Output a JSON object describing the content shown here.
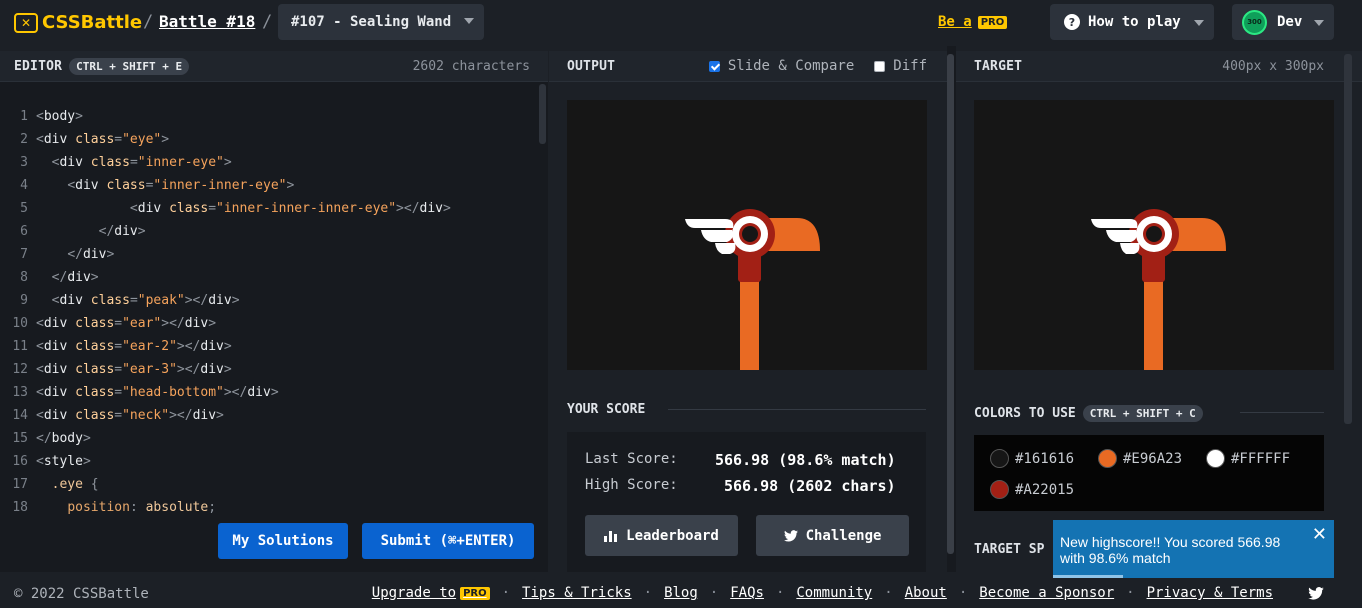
{
  "header": {
    "logo_text": "CSSBattle",
    "battle": "Battle #18",
    "target_select": "#107 - Sealing Wand",
    "be_a": "Be a",
    "pro": "PRO",
    "how_to_play": "How to play",
    "avatar_text": "300",
    "user": "Dev"
  },
  "editor": {
    "title": "EDITOR",
    "shortcut": "CTRL + SHIFT + E",
    "char_count": "2602 characters",
    "lines": [
      {
        "n": "1",
        "tokens": [
          [
            "c-p",
            "<"
          ],
          [
            "c-t",
            "body"
          ],
          [
            "c-p",
            ">"
          ]
        ]
      },
      {
        "n": "2",
        "tokens": [
          [
            "c-p",
            "<"
          ],
          [
            "c-t",
            "div "
          ],
          [
            "c-a",
            "class"
          ],
          [
            "c-p",
            "="
          ],
          [
            "c-s",
            "\"eye\""
          ],
          [
            "c-p",
            ">"
          ]
        ]
      },
      {
        "n": "3",
        "tokens": [
          [
            "c-x",
            "  "
          ],
          [
            "c-p",
            "<"
          ],
          [
            "c-t",
            "div "
          ],
          [
            "c-a",
            "class"
          ],
          [
            "c-p",
            "="
          ],
          [
            "c-s",
            "\"inner-eye\""
          ],
          [
            "c-p",
            ">"
          ]
        ]
      },
      {
        "n": "4",
        "tokens": [
          [
            "c-x",
            "    "
          ],
          [
            "c-p",
            "<"
          ],
          [
            "c-t",
            "div "
          ],
          [
            "c-a",
            "class"
          ],
          [
            "c-p",
            "="
          ],
          [
            "c-s",
            "\"inner-inner-eye\""
          ],
          [
            "c-p",
            ">"
          ]
        ]
      },
      {
        "n": "5",
        "tokens": [
          [
            "c-x",
            "            "
          ],
          [
            "c-p",
            "<"
          ],
          [
            "c-t",
            "div "
          ],
          [
            "c-a",
            "class"
          ],
          [
            "c-p",
            "="
          ],
          [
            "c-s",
            "\"inner-inner-inner-eye\""
          ],
          [
            "c-p",
            "></"
          ],
          [
            "c-t",
            "div"
          ],
          [
            "c-p",
            ">"
          ]
        ]
      },
      {
        "n": "6",
        "tokens": [
          [
            "c-x",
            "        "
          ],
          [
            "c-p",
            "</"
          ],
          [
            "c-t",
            "div"
          ],
          [
            "c-p",
            ">"
          ]
        ]
      },
      {
        "n": "7",
        "tokens": [
          [
            "c-x",
            "    "
          ],
          [
            "c-p",
            "</"
          ],
          [
            "c-t",
            "div"
          ],
          [
            "c-p",
            ">"
          ]
        ]
      },
      {
        "n": "8",
        "tokens": [
          [
            "c-x",
            "  "
          ],
          [
            "c-p",
            "</"
          ],
          [
            "c-t",
            "div"
          ],
          [
            "c-p",
            ">"
          ]
        ]
      },
      {
        "n": "9",
        "tokens": [
          [
            "c-x",
            "  "
          ],
          [
            "c-p",
            "<"
          ],
          [
            "c-t",
            "div "
          ],
          [
            "c-a",
            "class"
          ],
          [
            "c-p",
            "="
          ],
          [
            "c-s",
            "\"peak\""
          ],
          [
            "c-p",
            "></"
          ],
          [
            "c-t",
            "div"
          ],
          [
            "c-p",
            ">"
          ]
        ]
      },
      {
        "n": "10",
        "tokens": [
          [
            "c-p",
            "<"
          ],
          [
            "c-t",
            "div "
          ],
          [
            "c-a",
            "class"
          ],
          [
            "c-p",
            "="
          ],
          [
            "c-s",
            "\"ear\""
          ],
          [
            "c-p",
            "></"
          ],
          [
            "c-t",
            "div"
          ],
          [
            "c-p",
            ">"
          ]
        ]
      },
      {
        "n": "11",
        "tokens": [
          [
            "c-p",
            "<"
          ],
          [
            "c-t",
            "div "
          ],
          [
            "c-a",
            "class"
          ],
          [
            "c-p",
            "="
          ],
          [
            "c-s",
            "\"ear-2\""
          ],
          [
            "c-p",
            "></"
          ],
          [
            "c-t",
            "div"
          ],
          [
            "c-p",
            ">"
          ]
        ]
      },
      {
        "n": "12",
        "tokens": [
          [
            "c-p",
            "<"
          ],
          [
            "c-t",
            "div "
          ],
          [
            "c-a",
            "class"
          ],
          [
            "c-p",
            "="
          ],
          [
            "c-s",
            "\"ear-3\""
          ],
          [
            "c-p",
            "></"
          ],
          [
            "c-t",
            "div"
          ],
          [
            "c-p",
            ">"
          ]
        ]
      },
      {
        "n": "13",
        "tokens": [
          [
            "c-p",
            "<"
          ],
          [
            "c-t",
            "div "
          ],
          [
            "c-a",
            "class"
          ],
          [
            "c-p",
            "="
          ],
          [
            "c-s",
            "\"head-bottom\""
          ],
          [
            "c-p",
            "></"
          ],
          [
            "c-t",
            "div"
          ],
          [
            "c-p",
            ">"
          ]
        ]
      },
      {
        "n": "14",
        "tokens": [
          [
            "c-p",
            "<"
          ],
          [
            "c-t",
            "div "
          ],
          [
            "c-a",
            "class"
          ],
          [
            "c-p",
            "="
          ],
          [
            "c-s",
            "\"neck\""
          ],
          [
            "c-p",
            "></"
          ],
          [
            "c-t",
            "div"
          ],
          [
            "c-p",
            ">"
          ]
        ]
      },
      {
        "n": "15",
        "tokens": [
          [
            "c-p",
            "</"
          ],
          [
            "c-t",
            "body"
          ],
          [
            "c-p",
            ">"
          ]
        ]
      },
      {
        "n": "16",
        "tokens": [
          [
            "c-p",
            "<"
          ],
          [
            "c-t",
            "style"
          ],
          [
            "c-p",
            ">"
          ]
        ]
      },
      {
        "n": "17",
        "tokens": [
          [
            "c-x",
            "  "
          ],
          [
            "c-sel",
            ".eye "
          ],
          [
            "c-p",
            "{"
          ]
        ]
      },
      {
        "n": "18",
        "tokens": [
          [
            "c-x",
            "    "
          ],
          [
            "c-prop",
            "position"
          ],
          [
            "c-p",
            ": "
          ],
          [
            "c-sel",
            "absolute"
          ],
          [
            "c-p",
            ";"
          ]
        ]
      }
    ],
    "my_solutions": "My Solutions",
    "submit": "Submit (⌘+ENTER)"
  },
  "output": {
    "title": "OUTPUT",
    "slide_compare": "Slide & Compare",
    "slide_compare_checked": true,
    "diff": "Diff",
    "diff_checked": false
  },
  "score": {
    "title": "YOUR SCORE",
    "last_label": "Last Score:",
    "last_value": "566.98 (98.6% match)",
    "high_label": "High Score:",
    "high_value": "566.98 (2602 chars)",
    "leaderboard": "Leaderboard",
    "challenge": "Challenge"
  },
  "target": {
    "title": "TARGET",
    "size": "400px x 300px",
    "colors_title": "COLORS TO USE",
    "colors_shortcut": "CTRL + SHIFT + C",
    "colors": [
      {
        "hex": "#161616",
        "label": "#161616"
      },
      {
        "hex": "#E96A23",
        "label": "#E96A23"
      },
      {
        "hex": "#FFFFFF",
        "label": "#FFFFFF"
      },
      {
        "hex": "#A22015",
        "label": "#A22015"
      }
    ],
    "spec_title": "TARGET SP"
  },
  "toast": {
    "message": "New highscore!! You scored 566.98 with 98.6% match",
    "progress": 0.25
  },
  "footer": {
    "copyright": "© 2022 CSSBattle",
    "links": [
      "Upgrade to",
      "Tips & Tricks",
      "Blog",
      "FAQs",
      "Community",
      "About",
      "Become a Sponsor",
      "Privacy & Terms"
    ],
    "pro": "PRO"
  },
  "icons": {
    "bar_chart": "bar-chart-icon",
    "twitter": "twitter-icon",
    "question": "question-icon",
    "close": "close-icon"
  }
}
